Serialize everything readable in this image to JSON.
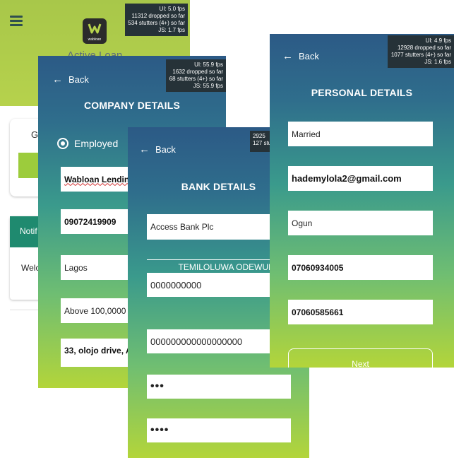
{
  "dashboard": {
    "app_logo_text": "wabloan",
    "active_loan_label": "Active Loan",
    "card_partial_text": "G",
    "notif_header_partial": "Notif",
    "welcome_partial": "Welc",
    "accent_color": "#1f8a6f",
    "perf": {
      "ui": "UI: 5.0 fps",
      "dropped": "11312 dropped so far",
      "stutters": "534 stutters (4+) so far",
      "js": "JS: 1.7 fps"
    }
  },
  "company_details": {
    "back_label": "Back",
    "title": "COMPANY DETAILS",
    "employment_option": "Employed",
    "company_name": "Wabloan Lendin",
    "phone": "09072419909",
    "state": "Lagos",
    "income": "Above 100,0000",
    "address": "33, olojo drive, A",
    "perf": {
      "ui": "UI: 55.9 fps",
      "dropped": "1632 dropped so far",
      "stutters": "68 stutters (4+) so far",
      "js": "JS: 55.9 fps"
    }
  },
  "bank_details": {
    "back_label": "Back",
    "title": "BANK DETAILS",
    "bank_name": "Access Bank Plc",
    "account_name": "TEMILOLUWA ODEWUMI",
    "account_number": "0000000000",
    "bvn": "000000000000000000",
    "pin_mask_1": "•••",
    "pin_mask_2": "••••",
    "perf": {
      "line1": "2925",
      "line2": "127 stu"
    }
  },
  "personal_details": {
    "back_label": "Back",
    "title": "PERSONAL DETAILS",
    "marital_status": "Married",
    "email": "hademylola2@gmail.com",
    "state": "Ogun",
    "phone_1": "07060934005",
    "phone_2": "07060585661",
    "next_label": "Next",
    "perf": {
      "ui": "UI: 4.9 fps",
      "dropped": "12928 dropped so far",
      "stutters": "1077 stutters (4+) so far",
      "js": "JS: 1.6 fps"
    }
  }
}
